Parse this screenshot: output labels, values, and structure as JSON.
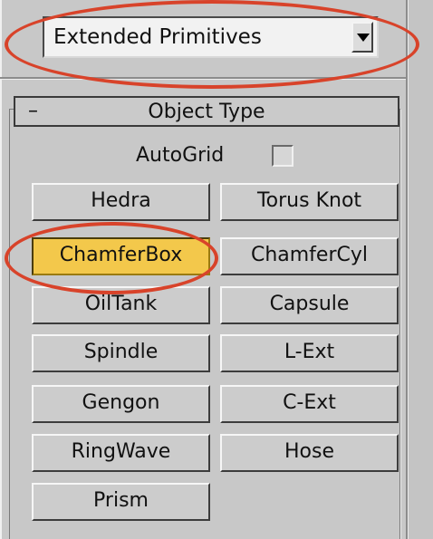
{
  "category_dropdown": {
    "selected": "Extended Primitives"
  },
  "rollout": {
    "toggle": "–",
    "title": "Object Type"
  },
  "autogrid": {
    "label": "AutoGrid",
    "checked": false
  },
  "buttons": [
    {
      "label": "Hedra",
      "active": false
    },
    {
      "label": "Torus Knot",
      "active": false
    },
    {
      "label": "ChamferBox",
      "active": true
    },
    {
      "label": "ChamferCyl",
      "active": false
    },
    {
      "label": "OilTank",
      "active": false
    },
    {
      "label": "Capsule",
      "active": false
    },
    {
      "label": "Spindle",
      "active": false
    },
    {
      "label": "L-Ext",
      "active": false
    },
    {
      "label": "Gengon",
      "active": false
    },
    {
      "label": "C-Ext",
      "active": false
    },
    {
      "label": "RingWave",
      "active": false
    },
    {
      "label": "Hose",
      "active": false
    },
    {
      "label": "Prism",
      "active": false
    }
  ],
  "colors": {
    "background": "#aee4f2",
    "panel": "#c8c8c8",
    "active_button": "#f3c84b",
    "highlight_oval": "#d8432a"
  },
  "icons": {
    "dropdown_arrow": "down-triangle-icon"
  }
}
